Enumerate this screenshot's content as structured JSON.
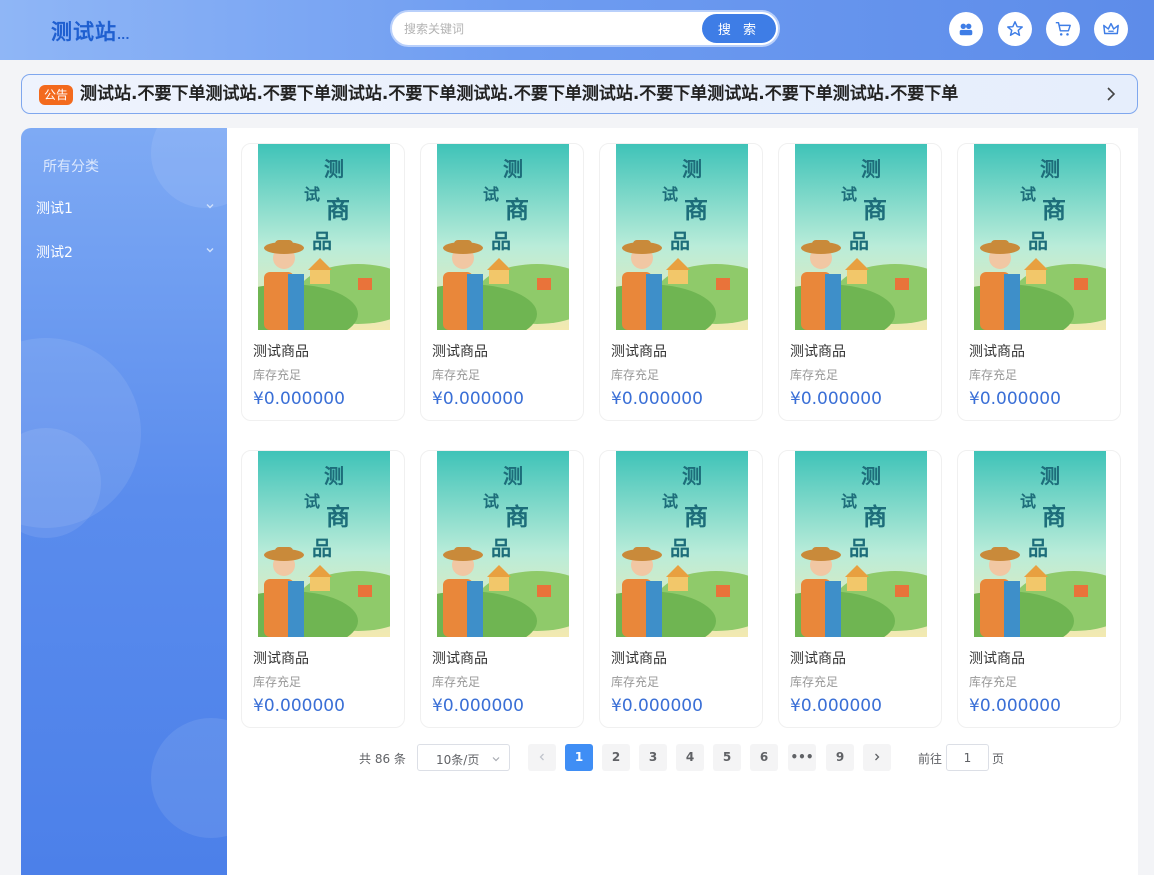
{
  "header": {
    "logo": "测试站",
    "logo_suffix": "...",
    "search_placeholder": "搜索关键词",
    "search_button": "搜 索",
    "icons": [
      "user-group-icon",
      "star-icon",
      "cart-icon",
      "crown-icon"
    ]
  },
  "notice": {
    "badge": "公告",
    "text": "测试站.不要下单测试站.不要下单测试站.不要下单测试站.不要下单测试站.不要下单测试站.不要下单测试站.不要下单"
  },
  "sidebar": {
    "title": "所有分类",
    "categories": [
      {
        "label": "测试1"
      },
      {
        "label": "测试2"
      }
    ]
  },
  "products": [
    {
      "name": "测试商品",
      "stock": "库存充足",
      "price": "¥0.000000",
      "image_text": "测试商品"
    },
    {
      "name": "测试商品",
      "stock": "库存充足",
      "price": "¥0.000000",
      "image_text": "测试商品"
    },
    {
      "name": "测试商品",
      "stock": "库存充足",
      "price": "¥0.000000",
      "image_text": "测试商品"
    },
    {
      "name": "测试商品",
      "stock": "库存充足",
      "price": "¥0.000000",
      "image_text": "测试商品"
    },
    {
      "name": "测试商品",
      "stock": "库存充足",
      "price": "¥0.000000",
      "image_text": "测试商品"
    },
    {
      "name": "测试商品",
      "stock": "库存充足",
      "price": "¥0.000000",
      "image_text": "测试商品"
    },
    {
      "name": "测试商品",
      "stock": "库存充足",
      "price": "¥0.000000",
      "image_text": "测试商品"
    },
    {
      "name": "测试商品",
      "stock": "库存充足",
      "price": "¥0.000000",
      "image_text": "测试商品"
    },
    {
      "name": "测试商品",
      "stock": "库存充足",
      "price": "¥0.000000",
      "image_text": "测试商品"
    },
    {
      "name": "测试商品",
      "stock": "库存充足",
      "price": "¥0.000000",
      "image_text": "测试商品"
    }
  ],
  "pagination": {
    "total": "共 86 条",
    "page_size": "10条/页",
    "pages": [
      "1",
      "2",
      "3",
      "4",
      "5",
      "6",
      "•••",
      "9"
    ],
    "current": "1",
    "goto_label": "前往",
    "goto_value": "1",
    "goto_unit": "页"
  },
  "colors": {
    "accent": "#3e7de6",
    "price": "#3a6fd6",
    "badge": "#f36a1d",
    "active_page": "#3f8ef5"
  }
}
